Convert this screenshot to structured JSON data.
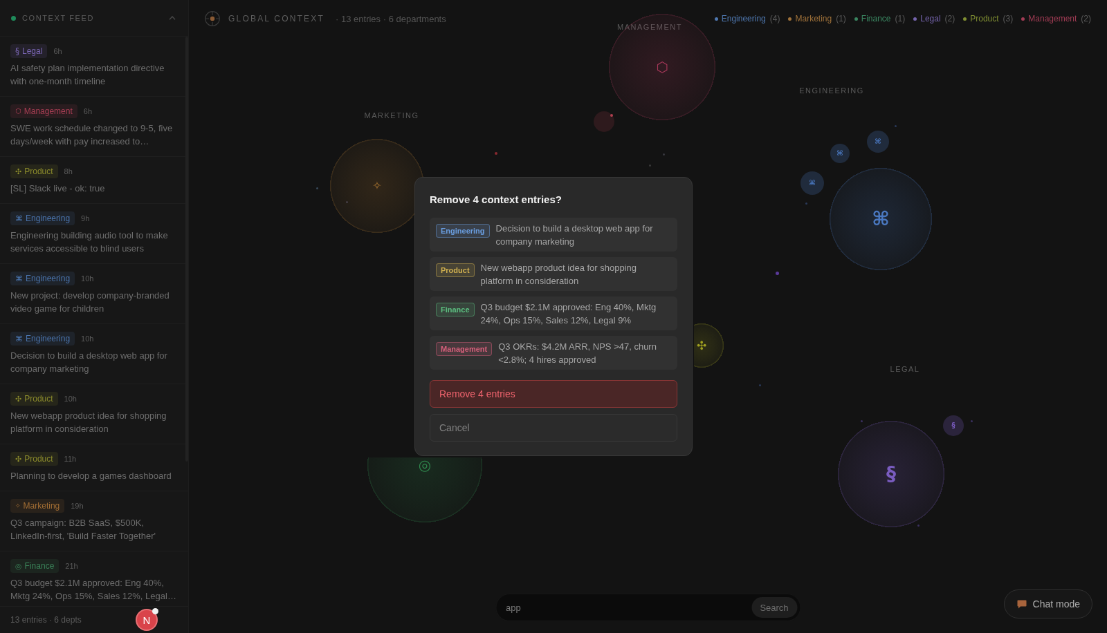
{
  "sidebar": {
    "title": "CONTEXT FEED",
    "items": [
      {
        "kind": "legal",
        "icon": "§",
        "department": "Legal",
        "color": "#7a66b4",
        "time": "6h",
        "text": "AI safety plan implementation directive with one-month timeline"
      },
      {
        "kind": "management",
        "icon": "⬡",
        "department": "Management",
        "color": "#a83e54",
        "time": "6h",
        "text": "SWE work schedule changed to 9-5, five days/week with pay increased to…"
      },
      {
        "kind": "product",
        "icon": "✣",
        "department": "Product",
        "color": "#8c8c2c",
        "time": "8h",
        "text": "[SL] Slack live - ok: true"
      },
      {
        "kind": "engineering",
        "icon": "⌘",
        "department": "Engineering",
        "color": "#4a74ad",
        "time": "9h",
        "text": "Engineering building audio tool to make services accessible to blind users"
      },
      {
        "kind": "engineering",
        "icon": "⌘",
        "department": "Engineering",
        "color": "#4a74ad",
        "time": "10h",
        "text": "New project: develop company-branded video game for children"
      },
      {
        "kind": "engineering",
        "icon": "⌘",
        "department": "Engineering",
        "color": "#4a74ad",
        "time": "10h",
        "text": "Decision to build a desktop web app for company marketing"
      },
      {
        "kind": "product",
        "icon": "✣",
        "department": "Product",
        "color": "#8c8c2c",
        "time": "10h",
        "text": "New webapp product idea for shopping platform in consideration"
      },
      {
        "kind": "product",
        "icon": "✣",
        "department": "Product",
        "color": "#8c8c2c",
        "time": "11h",
        "text": "Planning to develop a games dashboard"
      },
      {
        "kind": "marketing",
        "icon": "✧",
        "department": "Marketing",
        "color": "#a36e34",
        "time": "19h",
        "text": "Q3 campaign: B2B SaaS, $500K, LinkedIn-first, 'Build Faster Together'"
      },
      {
        "kind": "finance",
        "icon": "◎",
        "department": "Finance",
        "color": "#3a8258",
        "time": "21h",
        "text": "Q3 budget $2.1M approved: Eng 40%, Mktg 24%, Ops 15%, Sales 12%, Legal…"
      }
    ],
    "footer": "13 entries · 6 depts"
  },
  "header": {
    "title": "GLOBAL CONTEXT",
    "summary": "· 13 entries · 6 departments"
  },
  "legend": [
    {
      "label": "Engineering",
      "count": "(4)",
      "color": "#4f78b0"
    },
    {
      "label": "Marketing",
      "count": "(1)",
      "color": "#a0723a"
    },
    {
      "label": "Finance",
      "count": "(1)",
      "color": "#3a8560"
    },
    {
      "label": "Legal",
      "count": "(2)",
      "color": "#7564ad"
    },
    {
      "label": "Product",
      "count": "(3)",
      "color": "#808f32"
    },
    {
      "label": "Management",
      "count": "(2)",
      "color": "#a23c55"
    }
  ],
  "clusters": [
    {
      "kind": "management",
      "label": "MANAGEMENT",
      "icon": "⬡",
      "color": "#a8385a"
    },
    {
      "kind": "engineering",
      "label": "ENGINEERING",
      "icon": "⌘",
      "color": "#4a78c0"
    },
    {
      "kind": "marketing",
      "label": "MARKETING",
      "icon": "✧",
      "color": "#a87430"
    },
    {
      "kind": "product",
      "icon": "✣",
      "color": "#a0a020"
    },
    {
      "kind": "legal",
      "label": "LEGAL",
      "icon": "§",
      "color": "#7a5cc0"
    },
    {
      "kind": "finance",
      "icon": "◎",
      "color": "#30894e"
    }
  ],
  "dialog": {
    "title": "Remove 4 context entries?",
    "entries": [
      {
        "department": "Engineering",
        "color": "#6a9ee0",
        "text": "Decision to build a desktop web app for company marketing"
      },
      {
        "department": "Product",
        "color": "#d0b050",
        "text": "New webapp product idea for shopping platform in consideration"
      },
      {
        "department": "Finance",
        "color": "#5cbf80",
        "text": "Q3 budget $2.1M approved: Eng 40%, Mktg 24%, Ops 15%, Sales 12%, Legal 9%"
      },
      {
        "department": "Management",
        "color": "#d8607c",
        "text": "Q3 OKRs: $4.2M ARR, NPS >47, churn <2.8%; 4 hires approved"
      }
    ],
    "confirm": "Remove 4 entries",
    "cancel": "Cancel"
  },
  "satellites": [
    {
      "kind": "engineering",
      "icon": "⌘",
      "color": "#4a78c0"
    },
    {
      "kind": "engineering",
      "icon": "⌘",
      "color": "#4a78c0"
    },
    {
      "kind": "engineering",
      "icon": "⌘",
      "color": "#4a78c0"
    },
    {
      "kind": "legal",
      "icon": "§",
      "color": "#7a5cc0"
    }
  ],
  "search": {
    "value": "app",
    "button": "Search"
  },
  "chat_button": {
    "label": "Chat mode"
  },
  "dev_indicator": {
    "initial": "N",
    "has_issues": true
  }
}
